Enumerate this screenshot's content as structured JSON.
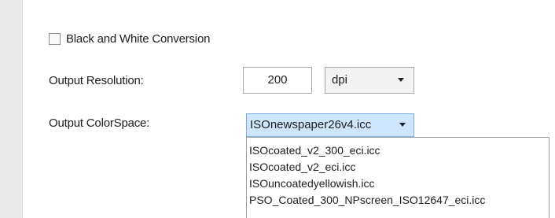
{
  "conversion": {
    "bw_label": "Black and White Conversion",
    "bw_checked": false
  },
  "resolution": {
    "label": "Output Resolution:",
    "value": "200",
    "unit": "dpi"
  },
  "colorspace": {
    "label": "Output ColorSpace:",
    "selected": "ISOnewspaper26v4.icc",
    "options": [
      "ISOcoated_v2_300_eci.icc",
      "ISOcoated_v2_eci.icc",
      "ISOuncoatedyellowish.icc",
      "PSO_Coated_300_NPscreen_ISO12647_eci.icc"
    ]
  }
}
